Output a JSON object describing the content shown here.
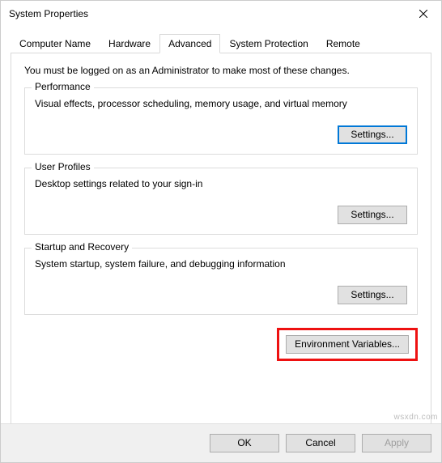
{
  "window": {
    "title": "System Properties"
  },
  "tabs": {
    "computer_name": "Computer Name",
    "hardware": "Hardware",
    "advanced": "Advanced",
    "system_protection": "System Protection",
    "remote": "Remote"
  },
  "advanced_panel": {
    "admin_note": "You must be logged on as an Administrator to make most of these changes.",
    "performance": {
      "title": "Performance",
      "desc": "Visual effects, processor scheduling, memory usage, and virtual memory",
      "button": "Settings..."
    },
    "user_profiles": {
      "title": "User Profiles",
      "desc": "Desktop settings related to your sign-in",
      "button": "Settings..."
    },
    "startup_recovery": {
      "title": "Startup and Recovery",
      "desc": "System startup, system failure, and debugging information",
      "button": "Settings..."
    },
    "env_vars_button": "Environment Variables..."
  },
  "footer": {
    "ok": "OK",
    "cancel": "Cancel",
    "apply": "Apply"
  },
  "watermark": "wsxdn.com"
}
